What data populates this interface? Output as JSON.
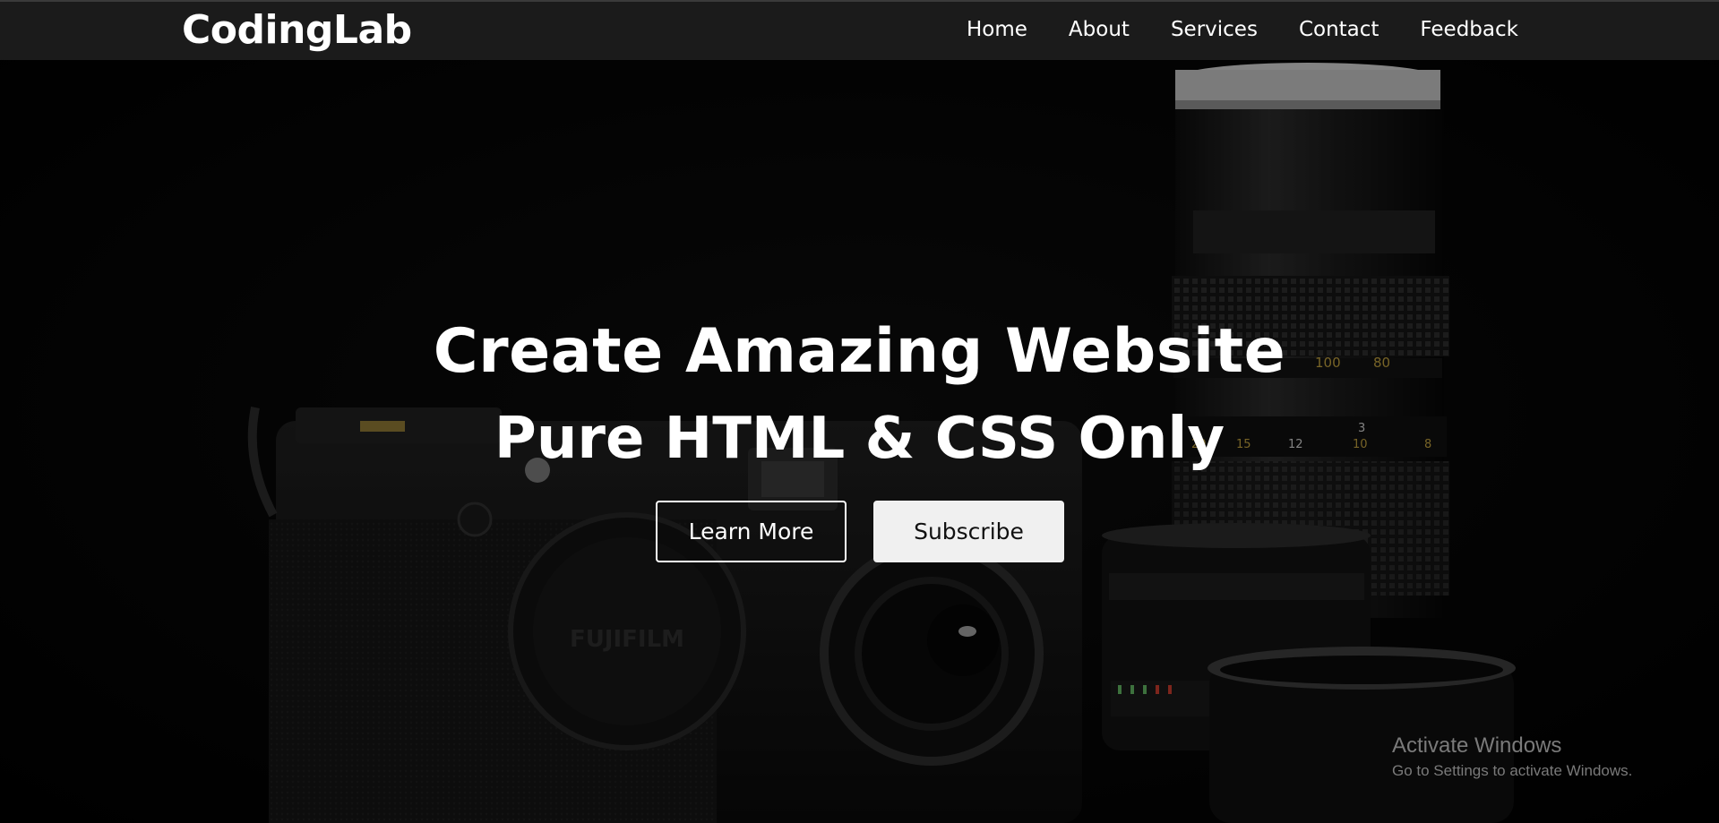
{
  "header": {
    "logo": "CodingLab",
    "nav": [
      {
        "label": "Home"
      },
      {
        "label": "About"
      },
      {
        "label": "Services"
      },
      {
        "label": "Contact"
      },
      {
        "label": "Feedback"
      }
    ]
  },
  "hero": {
    "title": "Create Amazing Website",
    "subtitle": "Pure HTML & CSS Only",
    "buttons": {
      "learn_more": "Learn More",
      "subscribe": "Subscribe"
    },
    "background_image": {
      "camera_brand": "FUJIFILM",
      "lens_scale_top": [
        "100",
        "80"
      ],
      "lens_scale_bottom": [
        "3",
        "20",
        "15",
        "12",
        "10",
        "8"
      ]
    }
  },
  "watermark": {
    "title": "Activate Windows",
    "subtitle": "Go to Settings to activate Windows."
  },
  "colors": {
    "navbar_bg": "#1b1b1b",
    "page_bg": "#030303",
    "text": "#ffffff",
    "button_solid_bg": "#f0f0f0",
    "watermark_text": "#7a7a7a"
  }
}
